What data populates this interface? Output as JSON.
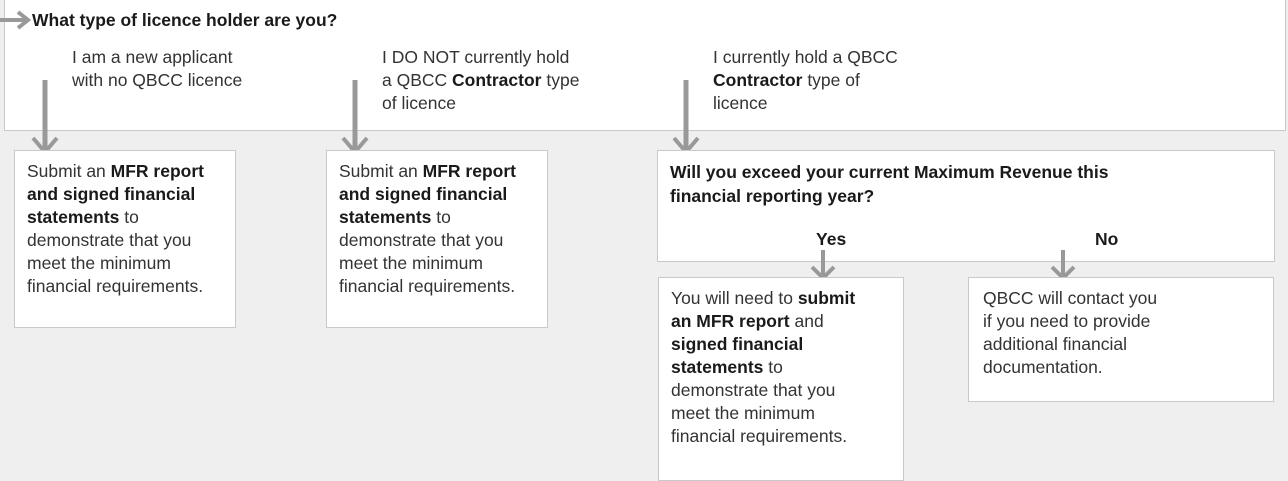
{
  "top": {
    "question": "What type of licence holder are you?",
    "options": [
      {
        "l1": "I am a new applicant",
        "l2": "with no QBCC licence",
        "l3": ""
      },
      {
        "l1": "I DO NOT currently hold",
        "l2a": "a QBCC ",
        "l2b": "Contractor",
        "l2c": " type",
        "l3": "of licence"
      },
      {
        "l1": "I currently hold a QBCC",
        "l2a": "",
        "l2b": "Contractor",
        "l2c": " type of",
        "l3": "licence"
      }
    ]
  },
  "outcome_new": {
    "l1": "Submit an ",
    "l1b": "MFR report",
    "l2": "and signed financial",
    "l3": "statements",
    "l3b": " to",
    "l4": "demonstrate that you",
    "l5": "meet the minimum",
    "l6": "financial requirements."
  },
  "outcome_no_contractor": {
    "l1": "Submit an ",
    "l1b": "MFR report",
    "l2": "and signed financial",
    "l3": "statements",
    "l3b": " to",
    "l4": "demonstrate that you",
    "l5": "meet the minimum",
    "l6": "financial requirements."
  },
  "revenue_question": {
    "l1": "Will you exceed your current Maximum Revenue this",
    "l2": "financial reporting year?",
    "yes": "Yes",
    "no": "No"
  },
  "outcome_yes": {
    "l1": "You will need to ",
    "l1b": "submit",
    "l2": "an MFR report",
    "l2b": " and",
    "l3": "signed financial",
    "l4": "statements",
    "l4b": " to",
    "l5": "demonstrate that you",
    "l6": "meet the minimum",
    "l7": "financial requirements."
  },
  "outcome_no": {
    "l1": "QBCC will contact you",
    "l2": "if you need to provide",
    "l3": "additional financial",
    "l4": "documentation."
  }
}
